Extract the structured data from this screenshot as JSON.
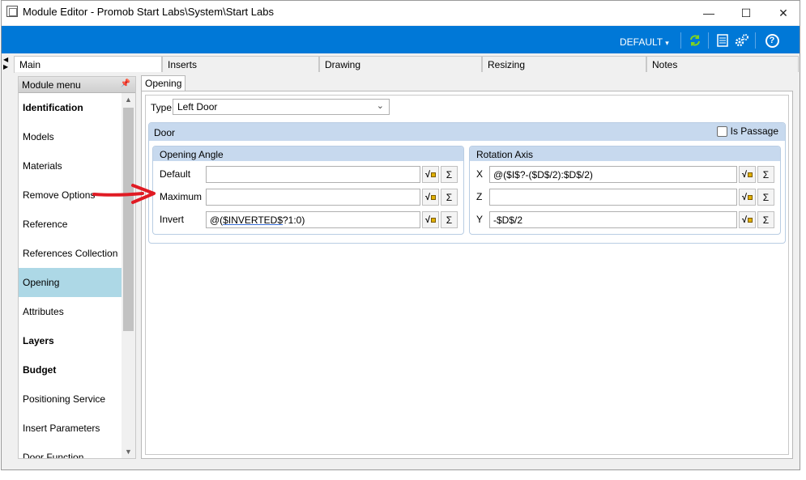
{
  "window": {
    "title": "Module Editor - Promob Start Labs\\System\\Start Labs",
    "minimize": "—",
    "maximize": "☐",
    "close": "✕"
  },
  "toolbar": {
    "profile_label": "DEFAULT",
    "profile_caret": "▾",
    "icons": [
      "refresh-icon",
      "list-icon",
      "settings-icon",
      "help-icon"
    ],
    "help_glyph": "?"
  },
  "main_tabs": [
    "Main",
    "Inserts",
    "Drawing",
    "Resizing",
    "Notes"
  ],
  "module_menu": {
    "header": "Module menu",
    "items": [
      {
        "label": "Identification",
        "bold": true
      },
      {
        "label": "Models",
        "bold": false
      },
      {
        "label": "Materials",
        "bold": false
      },
      {
        "label": "Remove Options",
        "bold": false
      },
      {
        "label": "Reference",
        "bold": false
      },
      {
        "label": "References Collection",
        "bold": false
      },
      {
        "label": "Opening",
        "bold": false,
        "selected": true
      },
      {
        "label": "Attributes",
        "bold": false
      },
      {
        "label": "Layers",
        "bold": true
      },
      {
        "label": "Budget",
        "bold": true
      },
      {
        "label": "Positioning Service",
        "bold": false
      },
      {
        "label": "Insert Parameters",
        "bold": false
      },
      {
        "label": "Door Function",
        "bold": false
      }
    ]
  },
  "opening": {
    "tab_label": "Opening",
    "type_label": "Type",
    "type_value": "Left Door",
    "door": {
      "title": "Door",
      "is_passage_label": "Is Passage",
      "is_passage_checked": false,
      "opening_angle": {
        "title": "Opening Angle",
        "default_label": "Default",
        "default_value": "",
        "maximum_label": "Maximum",
        "maximum_value": "",
        "invert_label": "Invert",
        "invert_value_prefix": "@(",
        "invert_value_underlined": "$INVERTED$",
        "invert_value_suffix": "?1:0)"
      },
      "rotation_axis": {
        "title": "Rotation Axis",
        "x_label": "X",
        "x_value": "@($I$?-($D$/2):$D$/2)",
        "z_label": "Z",
        "z_value": "",
        "y_label": "Y",
        "y_value": "-$D$/2"
      }
    }
  },
  "colors": {
    "accent_blue": "#0078d7",
    "group_header": "#c7d9ee",
    "selected_item": "#add8e6",
    "annotation_arrow": "#e01b24"
  }
}
